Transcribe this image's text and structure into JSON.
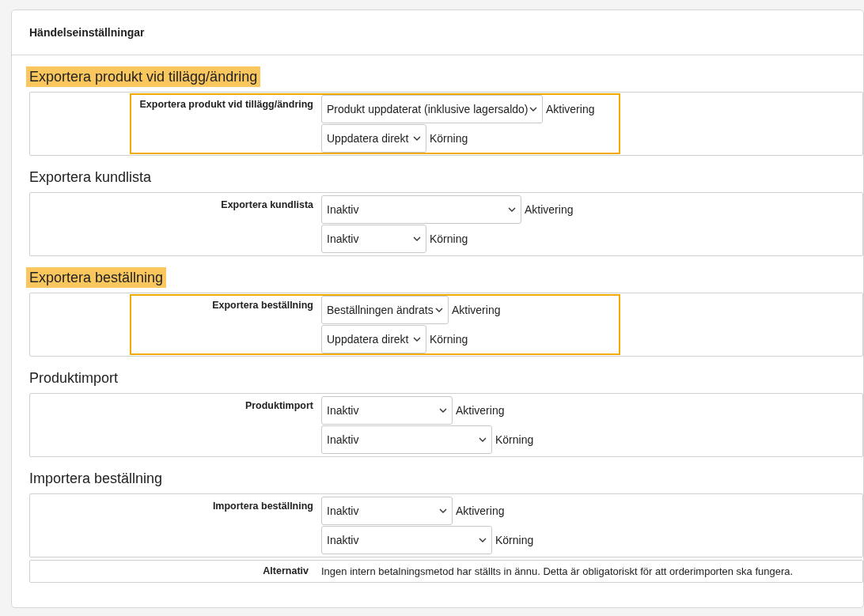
{
  "header": {
    "title": "Händelseinställningar"
  },
  "sections": [
    {
      "heading": "Exportera produkt vid tillägg/ändring",
      "highlighted": true,
      "settings": [
        {
          "kind": "selects",
          "label": "Exportera produkt vid tillägg/ändring",
          "selects": [
            {
              "value": "Produkt uppdaterat (inklusive lagersaldo)",
              "caption": "Aktivering"
            },
            {
              "value": "Uppdatera direkt",
              "caption": "Körning"
            }
          ]
        }
      ]
    },
    {
      "heading": "Exportera kundlista",
      "highlighted": false,
      "settings": [
        {
          "kind": "selects",
          "label": "Exportera kundlista",
          "selects": [
            {
              "value": "Inaktiv",
              "caption": "Aktivering"
            },
            {
              "value": "Inaktiv",
              "caption": "Körning"
            }
          ]
        }
      ]
    },
    {
      "heading": "Exportera beställning",
      "highlighted": true,
      "settings": [
        {
          "kind": "selects",
          "label": "Exportera beställning",
          "selects": [
            {
              "value": "Beställningen ändrats",
              "caption": "Aktivering"
            },
            {
              "value": "Uppdatera direkt",
              "caption": "Körning"
            }
          ]
        }
      ]
    },
    {
      "heading": "Produktimport",
      "highlighted": false,
      "settings": [
        {
          "kind": "selects",
          "label": "Produktimport",
          "selects": [
            {
              "value": "Inaktiv",
              "caption": "Aktivering"
            },
            {
              "value": "Inaktiv",
              "caption": "Körning"
            }
          ]
        }
      ]
    },
    {
      "heading": "Importera beställning",
      "highlighted": false,
      "settings": [
        {
          "kind": "selects",
          "label": "Importera beställning",
          "selects": [
            {
              "value": "Inaktiv",
              "caption": "Aktivering"
            },
            {
              "value": "Inaktiv",
              "caption": "Körning"
            }
          ]
        },
        {
          "kind": "note",
          "label": "Alternativ",
          "text": "Ingen intern betalningsmetod har ställts in ännu. Detta är obligatoriskt för att orderimporten ska fungera."
        }
      ]
    }
  ]
}
